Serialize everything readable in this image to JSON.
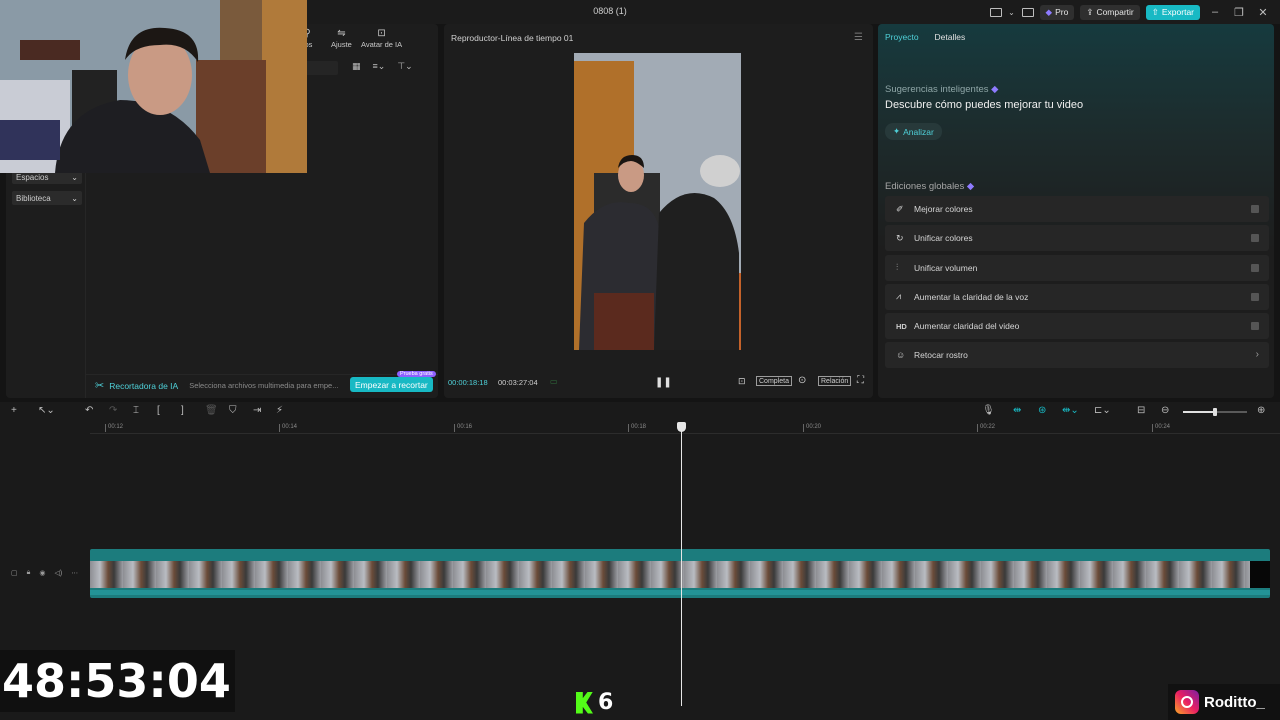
{
  "titlebar": {
    "title": "0808 (1)",
    "pro_label": "Pro",
    "share_label": "Compartir",
    "export_label": "Exportar"
  },
  "media_panel": {
    "tools": [
      {
        "icon": "filters-icon",
        "label": "ros"
      },
      {
        "icon": "adjust-icon",
        "label": "Ajuste"
      },
      {
        "icon": "ai-avatar-icon",
        "label": "Avatar de IA"
      }
    ],
    "sidebar": [
      {
        "label": "Espacios",
        "chevron": "⌄"
      },
      {
        "label": "Biblioteca",
        "chevron": "⌄"
      }
    ],
    "ai_cutter": {
      "title": "Recortadora de IA",
      "hint": "Selecciona archivos multimedia para empe...",
      "button": "Empezar a recortar",
      "badge": "Prueba gratis"
    }
  },
  "player": {
    "title": "Reproductor-Línea de tiempo 01",
    "current_time": "00:00:18:18",
    "total_time": "00:03:27:04",
    "full_label": "Completa",
    "ratio_label": "Relación"
  },
  "right_panel": {
    "tabs": [
      {
        "label": "Proyecto",
        "active": true
      },
      {
        "label": "Detalles",
        "active": false
      }
    ],
    "suggestions_label": "Sugerencias inteligentes",
    "suggestions_heading": "Descubre cómo puedes mejorar tu video",
    "analyze_label": "Analizar",
    "global_label": "Ediciones globales",
    "global_items": [
      {
        "icon": "✐",
        "label": "Mejorar colores",
        "type": "toggle"
      },
      {
        "icon": "↻",
        "label": "Unificar colores",
        "type": "toggle"
      },
      {
        "icon": "⫶",
        "label": "Unificar volumen",
        "type": "toggle"
      },
      {
        "icon": "⩘",
        "label": "Aumentar la claridad de la voz",
        "type": "toggle"
      },
      {
        "icon": "HD",
        "label": "Aumentar claridad del video",
        "type": "toggle"
      },
      {
        "icon": "☺",
        "label": "Retocar rostro",
        "type": "chevron"
      }
    ]
  },
  "timeline": {
    "ruler_ticks": [
      "00:12",
      "00:14",
      "00:16",
      "00:18",
      "00:20",
      "00:22",
      "00:24"
    ],
    "playhead_time": "00:00:18:18"
  },
  "overlays": {
    "stream_timer": "48:53:04",
    "kick_count": "6",
    "instagram_handle": "Roditto_"
  },
  "colors": {
    "accent": "#18b9c4",
    "clip": "#1c7c7d",
    "kick": "#53fc18"
  }
}
